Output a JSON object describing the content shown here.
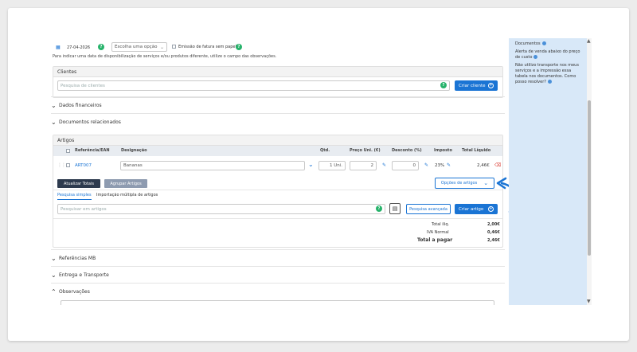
{
  "top": {
    "date": "27-04-2026",
    "option_select": "Escolha uma opção",
    "paperless_label": "Emissão de fatura sem papel",
    "note": "Para indicar uma data de disponibilização de serviços e/ou produtos diferente, utilize o campo das observações."
  },
  "clients": {
    "title": "Clientes",
    "search_placeholder": "Pesquisa de clientes",
    "create_label": "Criar cliente"
  },
  "sections": {
    "financial": "Dados financeiros",
    "related_docs": "Documentos relacionados",
    "mb_refs": "Referências MB",
    "delivery": "Entrega e Transporte",
    "notes": "Observações"
  },
  "articles": {
    "title": "Artigos",
    "headers": {
      "ref": "Referência/EAN",
      "designation": "Designação",
      "qty": "Qtd.",
      "unit_price": "Preço Uni. (€)",
      "discount": "Desconto (%)",
      "tax": "Imposto",
      "total": "Total Líquido"
    },
    "row": {
      "ref": "ART007",
      "designation": "Bananas",
      "qty": "1 Uni.",
      "price": "2",
      "discount": "0",
      "tax": "23%",
      "total": "2,46€"
    },
    "update_totals": "Atualizar Totais",
    "group_articles": "Agrupar Artigos",
    "article_options": "Opções de artigos",
    "tab_simple": "Pesquisa simples",
    "tab_import": "Importação múltipla de artigos",
    "search_placeholder": "Pesquisar em artigos",
    "advanced_search": "Pesquisa avançada",
    "create_article": "Criar artigo"
  },
  "totals": {
    "liq_label": "Total iliq.",
    "liq_value": "2,00€",
    "vat_label": "IVA Normal",
    "vat_value": "0,46€",
    "pay_label": "Total a pagar",
    "pay_value": "2,46€"
  },
  "side": {
    "item1": "Documentos",
    "item2": "Alerta de venda abaixo do preço de custo",
    "item3": "Não utilizo transporte nos meus serviços e a impressão essa tabela nos documentos. Como posso resolver?"
  },
  "colors": {
    "primary": "#1a74d4",
    "dark_button": "#2d3a4e",
    "gray_button": "#8e9bb0",
    "help_green": "#27b36b",
    "side_bg": "#d8e8f8"
  }
}
